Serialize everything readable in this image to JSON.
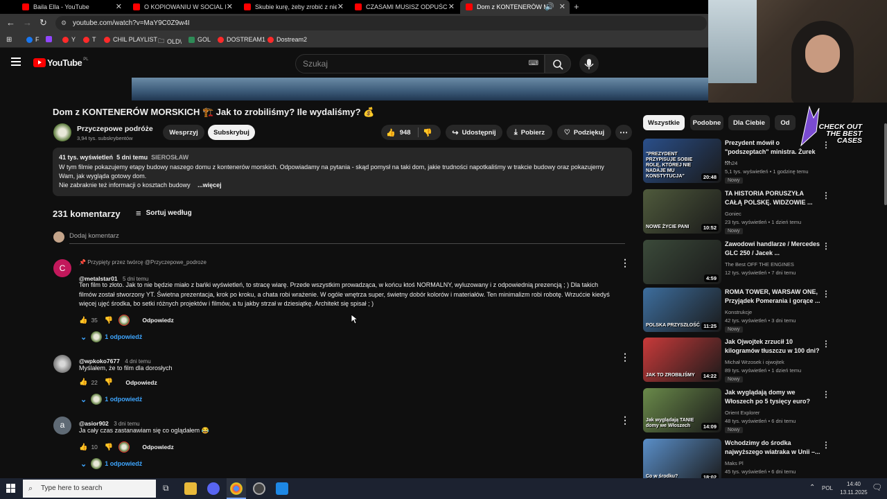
{
  "tabs": [
    {
      "label": "Baila Ella - YouTube"
    },
    {
      "label": "O KOPIOWANIU W SOCIAL ME"
    },
    {
      "label": "Skubie kurę, żeby zrobić z niej"
    },
    {
      "label": "CZASAMI MUSISZ ODPUŚCIĆ..."
    },
    {
      "label": "Dom z KONTENERÓW MOR"
    }
  ],
  "address_bar": {
    "url": "youtube.com/watch?v=MaY9C0Z9w4I"
  },
  "bookmarks": [
    {
      "label": "F"
    },
    {
      "label": ""
    },
    {
      "label": "Y"
    },
    {
      "label": "T"
    },
    {
      "label": "CHIL PLAYLIST"
    },
    {
      "label": "OLD\\"
    },
    {
      "label": "GOL"
    },
    {
      "label": "DOSTREAM1"
    },
    {
      "label": "Dostream2"
    }
  ],
  "header": {
    "logo_text": "YouTube",
    "region": "PL",
    "search_placeholder": "Szukaj"
  },
  "video": {
    "title": "Dom z KONTENERÓW MORSKICH 🏗️ Jak to zrobiliśmy? Ile wydaliśmy? 💰",
    "channel": "Przyczepowe podróże",
    "subscribers": "3,94 tys. subskrybentów",
    "support_label": "Wesprzyj",
    "subscribe_label": "Subskrybuj",
    "likes": "948",
    "share_label": "Udostępnij",
    "download_label": "Pobierz",
    "thanks_label": "Podziękuj"
  },
  "description": {
    "views": "41 tys. wyświetleń",
    "age": "5 dni temu",
    "location": "SIEROSŁAW",
    "line1": "W tym filmie pokazujemy etapy budowy naszego domu z kontenerów morskich. Odpowiadamy na pytania - skąd pomysł na taki dom, jakie trudności napotkaliśmy w trakcie budowy oraz pokazujemy",
    "line2": "Wam, jak wygląda gotowy dom.",
    "line3": "Nie zabraknie też informacji o kosztach budowy",
    "more": "...więcej"
  },
  "comments_section": {
    "count": "231 komentarzy",
    "sort_label": "Sortuj według",
    "add_placeholder": "Dodaj komentarz"
  },
  "comments": [
    {
      "pinned": "Przypięty przez twórcę @Przyczepowe_podroze",
      "avatar_letter": "C",
      "author": "@metalstar01",
      "age": "5 dni temu",
      "text_lines": [
        "Ten film to złoto. Jak to nie będzie miało z bańki wyświetleń, to stracę wiarę. Przede wszystkim prowadząca, w końcu ktoś NORMALNY, wyluzowany i z odpowiednią prezencją ;  )  Dla takich",
        "filmów został stworzony YT. Świetna prezentacja, krok po kroku, a chata robi wrażenie. W ogóle wnętrza super, świetny dobór kolorów i materiałów. Ten minimalizm robi robotę. Wrzućcie kiedyś",
        "więcej ujęć środka, bo setki różnych projektów i filmów, a tu jakby strzał w dziesiątkę. Architekt się spisał ; )"
      ],
      "likes": "35",
      "reply_label": "Odpowiedz",
      "replies": "1 odpowiedź"
    },
    {
      "author": "@wpkoko7677",
      "age": "4 dni temu",
      "text_lines": [
        "Myślałem, że to film dla dorosłych"
      ],
      "likes": "22",
      "reply_label": "Odpowiedz",
      "replies": "1 odpowiedź"
    },
    {
      "avatar_letter": "a",
      "author": "@asior902",
      "age": "3 dni temu",
      "text_lines": [
        "Ja cały czas zastanawiam się co oglądałem 😂"
      ],
      "likes": "10",
      "reply_label": "Odpowiedz",
      "replies": "1 odpowiedź"
    }
  ],
  "chips": [
    {
      "label": "Wszystkie",
      "selected": true
    },
    {
      "label": "Podobne"
    },
    {
      "label": "Dla Ciebie"
    },
    {
      "label": "Od"
    }
  ],
  "overlay_banner": {
    "line1": "CHECK OUT",
    "line2": "THE BEST",
    "line3": "CASES"
  },
  "recommendations": [
    {
      "title": "Prezydent mówił o \"podszeptach\" ministra. Żurek ...",
      "channel": "tvn24",
      "meta": "5,1 tys. wyświetleń • 1 godzinę temu",
      "badge": "Nowy",
      "duration": "20:48",
      "thumb_text": "\"PREZYDENT PRZYPISUJE SOBIE ROLĘ, KTÓREJ NIE NADAJE MU KONSTYTUCJA\"",
      "color": "#2a4f8a"
    },
    {
      "title": "TA HISTORIA PORUSZYŁA CAŁĄ POLSKĘ. WIDZOWIE ...",
      "channel": "Goniec",
      "meta": "23 tys. wyświetleń • 1 dzień temu",
      "badge": "Nowy",
      "duration": "10:52",
      "thumb_text": "NOWE ŻYCIE PANI",
      "color": "#4f5a3c"
    },
    {
      "title": "Zawodowi handlarze / Mercedes GLC 250 / Jacek ...",
      "channel": "The Best OFF THE ENGINES",
      "meta": "12 tys. wyświetleń • 7 dni temu",
      "badge": "",
      "duration": "4:59",
      "thumb_text": "",
      "color": "#3b4a3a"
    },
    {
      "title": "ROMA TOWER, WARSAW ONE, Przyjądek Pomerania i gorące ...",
      "channel": "Konstrukcje",
      "meta": "42 tys. wyświetleń • 3 dni temu",
      "badge": "Nowy",
      "duration": "11:25",
      "thumb_text": "POLSKA PRZYSZŁOŚĆ",
      "color": "#3d6e9e"
    },
    {
      "title": "Jak Ojwojtek zrzucił 10 kilogramów tłuszczu w 100 dni?",
      "channel": "Michał Wrzosek i ojwojtek",
      "meta": "89 tys. wyświetleń • 1 dzień temu",
      "badge": "Nowy",
      "duration": "14:22",
      "thumb_text": "JAK TO ZROBIŁIŚMY",
      "color": "#c93a3a"
    },
    {
      "title": "Jak wyglądają domy we Włoszech po 5 tysięcy euro?",
      "channel": "Orient Explorer",
      "meta": "48 tys. wyświetleń • 6 dni temu",
      "badge": "Nowy",
      "duration": "14:09",
      "thumb_text": "Jak wyglądają TANIE domy we Włoszech",
      "color": "#6a8a4a"
    },
    {
      "title": "Wchodzimy do środka najwyższego wiatraka w Unii –...",
      "channel": "Maks Pl",
      "meta": "45 tys. wyświetleń • 6 dni temu",
      "badge": "",
      "duration": "18:02",
      "thumb_text": "Co w środku?",
      "color": "#5a8fc9"
    }
  ],
  "taskbar": {
    "search_placeholder": "Type here to search",
    "lang": "POL",
    "time": "14:40",
    "date": "13.11.2025"
  }
}
